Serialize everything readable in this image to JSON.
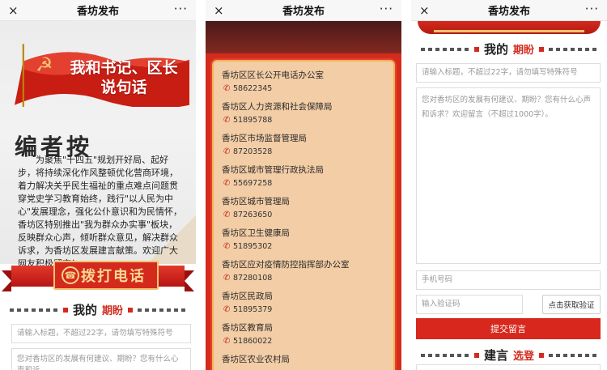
{
  "app": {
    "title": "香坊发布",
    "close_icon": "×",
    "more_icon": "···"
  },
  "panel1": {
    "hero_title_line1": "我和书记、区长",
    "hero_title_line2": "说句话",
    "editor_note_title": "编者按",
    "editor_note_body": "为聚焦\"十四五\"规划开好局、起好步，将持续深化作风整顿优化营商环境，着力解决关乎民生福祉的重点难点问题贯穿党史学习教育始终，践行\"以人民为中心\"发展理念，强化公仆意识和为民情怀，香坊区特别推出\"我为群众办实事\"板块，反映群众心声，倾听群众意见，解决群众诉求，为香坊区发展建言献策。欢迎广大网友积极留言！",
    "call_banner_label": "拨打电话",
    "hope_title_main": "我的",
    "hope_title_accent": "期盼",
    "title_placeholder": "请输入标题，不超过22字，请勿填写特殊符号",
    "content_placeholder": "您对香坊区的发展有何建议、期盼？您有什么心声和诉"
  },
  "panel2": {
    "departments": [
      {
        "name": "香坊区区长公开电话办公室",
        "phone": "58622345"
      },
      {
        "name": "香坊区人力资源和社会保障局",
        "phone": "51895788"
      },
      {
        "name": "香坊区市场监督管理局",
        "phone": "87203528"
      },
      {
        "name": "香坊区城市管理行政执法局",
        "phone": "55697258"
      },
      {
        "name": "香坊区城市管理局",
        "phone": "87263650"
      },
      {
        "name": "香坊区卫生健康局",
        "phone": "51895302"
      },
      {
        "name": "香坊区应对疫情防控指挥部办公室",
        "phone": "87280108"
      },
      {
        "name": "香坊区民政局",
        "phone": "51895379"
      },
      {
        "name": "香坊区教育局",
        "phone": "51860022"
      },
      {
        "name": "香坊区农业农村局",
        "phone": ""
      }
    ]
  },
  "panel3": {
    "hope_title_main": "我的",
    "hope_title_accent": "期盼",
    "title_placeholder": "请输入标题，不超过22字，请勿填写特殊符号",
    "content_placeholder": "您对香坊区的发展有何建议、期盼？您有什么心声和诉求？欢迎留言（不超过1000字）。",
    "phone_placeholder": "手机号码",
    "code_placeholder": "输入验证码",
    "get_code_label": "点击获取验证",
    "submit_label": "提交留言",
    "suggest_title_main": "建言",
    "suggest_title_accent": "选登"
  },
  "colors": {
    "brand_red": "#d8271c",
    "gold": "#f3c170",
    "card_peach": "#f3cda6"
  },
  "icons": [
    "close-icon",
    "more-icon",
    "phone-icon",
    "party-emblem-icon"
  ]
}
